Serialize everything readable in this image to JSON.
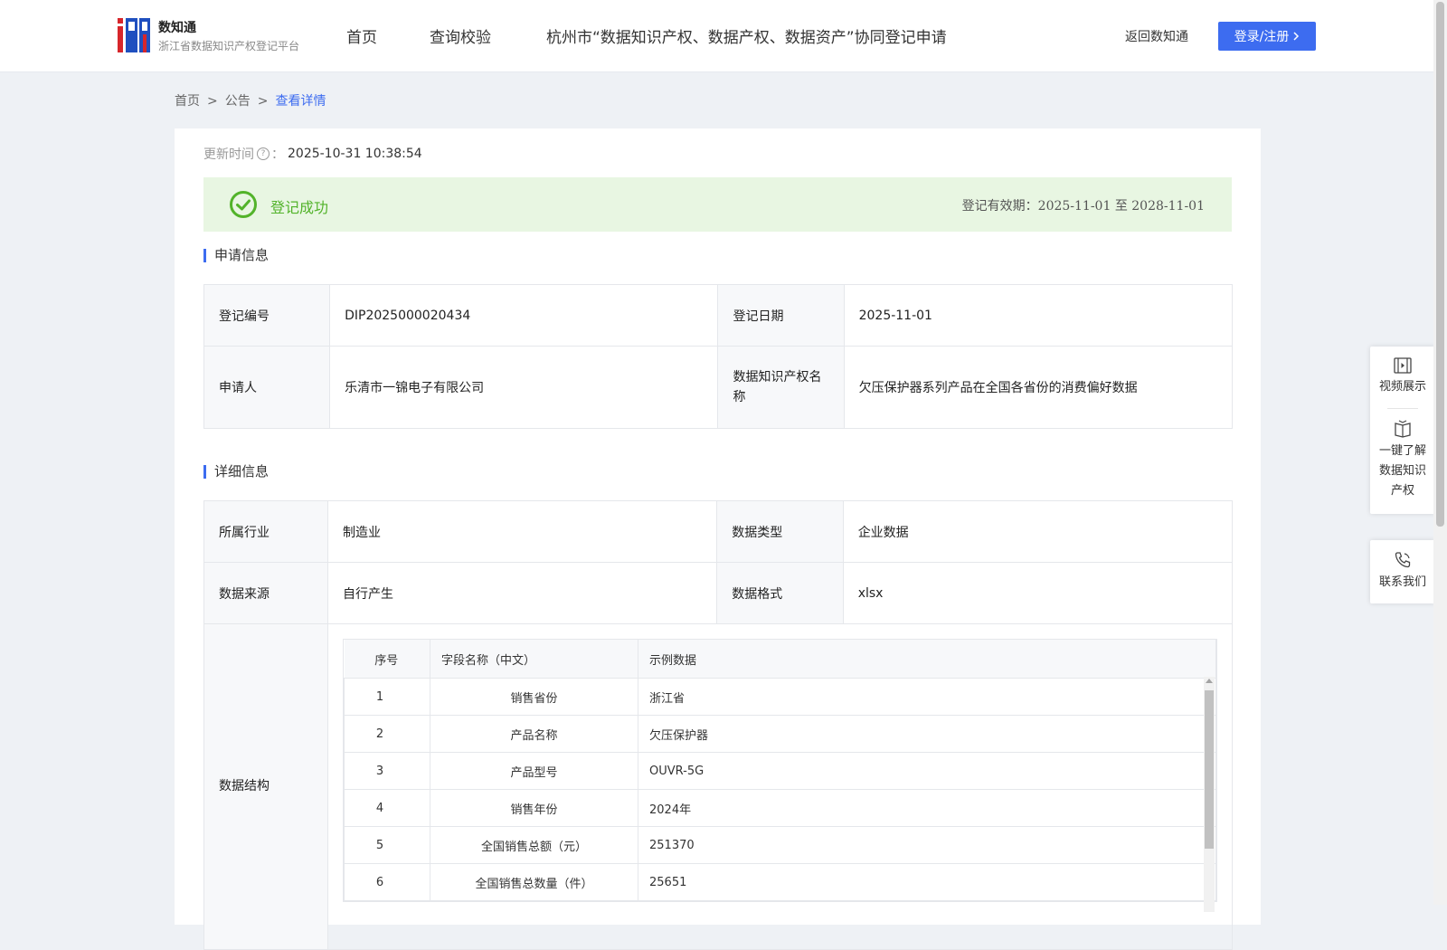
{
  "header": {
    "brand_name": "数知通",
    "brand_sub": "浙江省数据知识产权登记平台",
    "nav": [
      "首页",
      "查询校验",
      "杭州市“数据知识产权、数据产权、数据资产”协同登记申请"
    ],
    "back_link": "返回数知通",
    "login_label": "登录/注册"
  },
  "breadcrumb": {
    "items": [
      "首页",
      "公告",
      "查看详情"
    ],
    "separator": ">"
  },
  "update": {
    "label": "更新时间",
    "colon": "：",
    "value": "2025-10-31 10:38:54"
  },
  "status": {
    "text": "登记成功",
    "validity_label": "登记有效期：",
    "validity_value": "2025-11-01 至 2028-11-01",
    "color": "#52b32a"
  },
  "application": {
    "title": "申请信息",
    "rows": [
      [
        {
          "label": "登记编号",
          "value": "DIP2025000020434"
        },
        {
          "label": "登记日期",
          "value": "2025-11-01"
        }
      ],
      [
        {
          "label": "申请人",
          "value": "乐清市一锦电子有限公司"
        },
        {
          "label": "数据知识产权名称",
          "value": "欠压保护器系列产品在全国各省份的消费偏好数据"
        }
      ]
    ]
  },
  "details": {
    "title": "详细信息",
    "rows": [
      [
        {
          "label": "所属行业",
          "value": "制造业"
        },
        {
          "label": "数据类型",
          "value": "企业数据"
        }
      ],
      [
        {
          "label": "数据来源",
          "value": "自行产生"
        },
        {
          "label": "数据格式",
          "value": "xlsx"
        }
      ]
    ],
    "structure_label": "数据结构",
    "structure_headers": [
      "序号",
      "字段名称（中文）",
      "示例数据"
    ],
    "structure_rows": [
      [
        "1",
        "销售省份",
        "浙江省"
      ],
      [
        "2",
        "产品名称",
        "欠压保护器"
      ],
      [
        "3",
        "产品型号",
        "OUVR-5G"
      ],
      [
        "4",
        "销售年份",
        "2024年"
      ],
      [
        "5",
        "全国销售总额（元）",
        "251370"
      ],
      [
        "6",
        "全国销售总数量（件）",
        "25651"
      ]
    ]
  },
  "float_panel": {
    "video": "视频展示",
    "learn": "一键了解数据知识产权",
    "contact": "联系我们"
  },
  "colors": {
    "accent": "#3d6cf0",
    "success_bg": "#e8f6e2"
  }
}
